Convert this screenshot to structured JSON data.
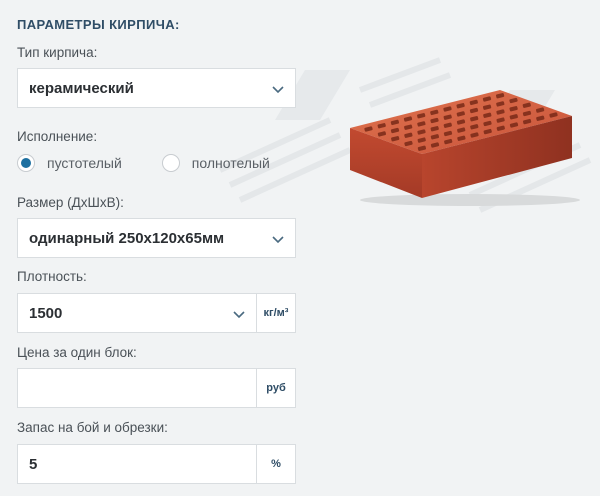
{
  "section_title": "ПАРАМЕТРЫ КИРПИЧА:",
  "brick_type": {
    "label": "Тип кирпича:",
    "value": "керамический"
  },
  "variant": {
    "label": "Исполнение:",
    "options": [
      {
        "label": "пустотелый",
        "selected": true
      },
      {
        "label": "полнотелый",
        "selected": false
      }
    ]
  },
  "size": {
    "label": "Размер (ДхШхВ):",
    "value": "одинарный 250х120х65мм"
  },
  "density": {
    "label": "Плотность:",
    "value": "1500",
    "unit": "кг/м³"
  },
  "price": {
    "label": "Цена за один блок:",
    "value": "",
    "unit": "руб"
  },
  "reserve": {
    "label": "Запас на бой и обрезки:",
    "value": "5",
    "unit": "%"
  },
  "colors": {
    "accent": "#1d6fa0",
    "title": "#2f4d66",
    "brick": "#c9533a"
  },
  "icons": {
    "dropdown": "chevron-down-icon",
    "image": "brick-image"
  }
}
